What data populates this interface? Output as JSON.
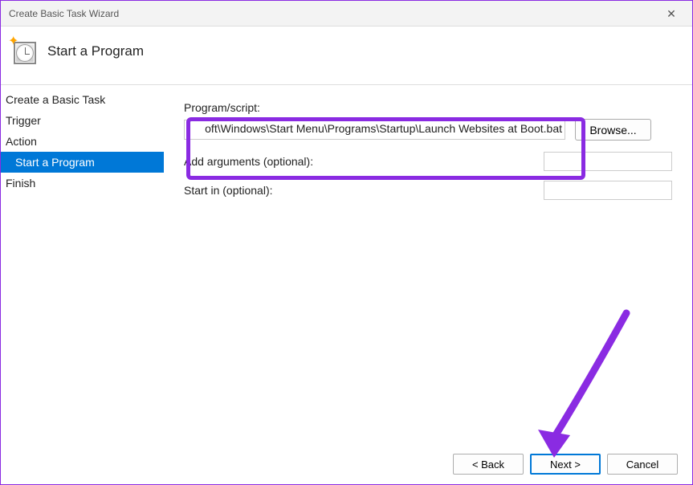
{
  "window": {
    "title": "Create Basic Task Wizard",
    "close_symbol": "✕"
  },
  "header": {
    "title": "Start a Program"
  },
  "sidebar": {
    "items": [
      {
        "label": "Create a Basic Task",
        "selected": false,
        "indent": false
      },
      {
        "label": "Trigger",
        "selected": false,
        "indent": false
      },
      {
        "label": "Action",
        "selected": false,
        "indent": false
      },
      {
        "label": "Start a Program",
        "selected": true,
        "indent": true
      },
      {
        "label": "Finish",
        "selected": false,
        "indent": false
      }
    ]
  },
  "form": {
    "program_label": "Program/script:",
    "program_value": "oft\\Windows\\Start Menu\\Programs\\Startup\\Launch Websites at Boot.bat",
    "browse_button": "Browse...",
    "args_label": "Add arguments (optional):",
    "args_value": "",
    "startin_label": "Start in (optional):",
    "startin_value": ""
  },
  "buttons": {
    "back": "< Back",
    "next": "Next >",
    "cancel": "Cancel"
  },
  "annotations": {
    "highlight_color": "#8a2be2"
  }
}
